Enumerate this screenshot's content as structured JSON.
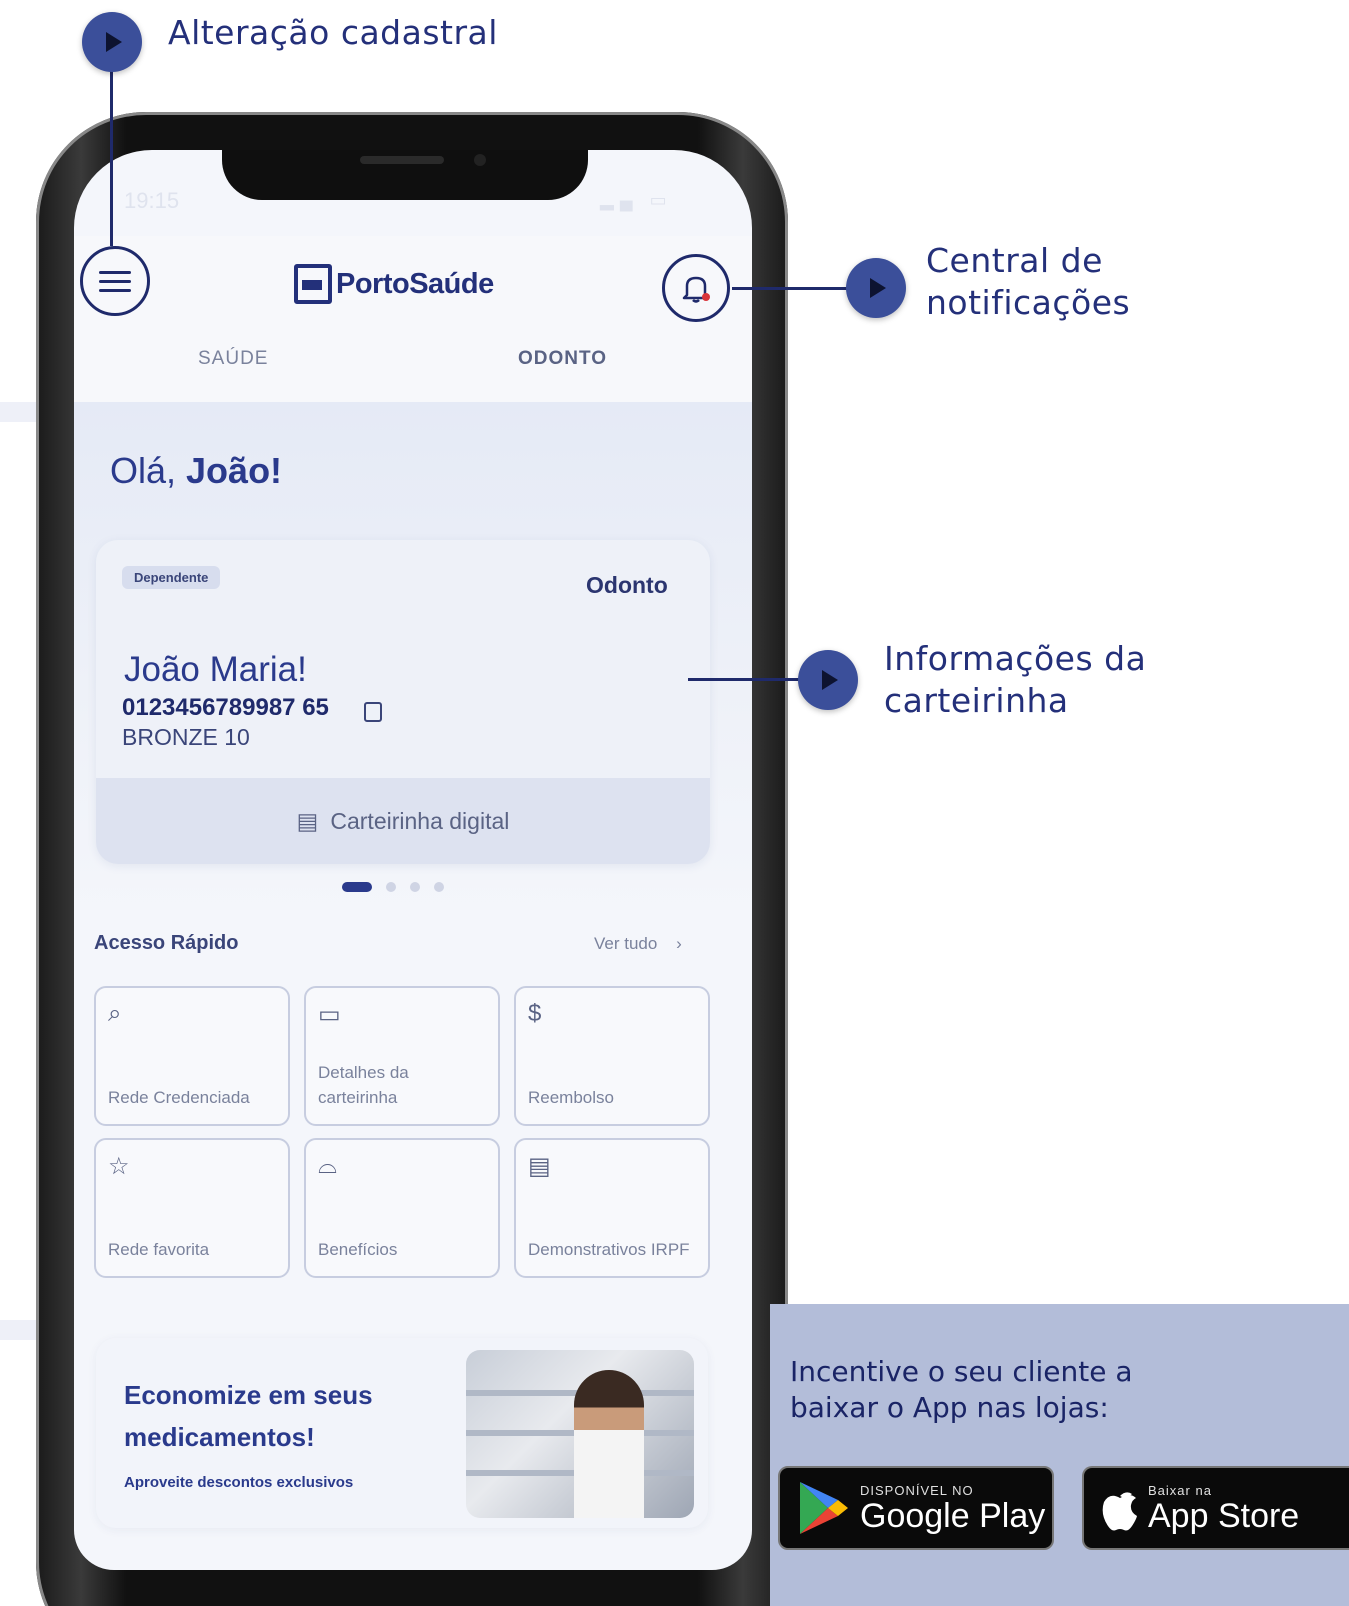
{
  "callouts": {
    "profile": "Alteração cadastral",
    "notifications_line1": "Central de",
    "notifications_line2": "notificações",
    "card_line1": "Informações da",
    "card_line2": "carteirinha"
  },
  "status": {
    "time": "19:15"
  },
  "app": {
    "logo_text": "PortoSaúde",
    "tabs": [
      {
        "label": "SAÚDE",
        "active": false
      },
      {
        "label": "ODONTO",
        "active": true
      }
    ],
    "greeting_prefix": "Olá, ",
    "greeting_name": "João!",
    "card": {
      "badge": "Dependente",
      "type": "Odonto",
      "name": "João Maria!",
      "number": "0123456789987 65",
      "plan": "BRONZE 10",
      "button": "Carteirinha digital"
    },
    "quick_access": {
      "title": "Acesso Rápido",
      "see_all": "Ver tudo",
      "tiles": [
        {
          "icon": "search-icon",
          "label": "Rede Credenciada"
        },
        {
          "icon": "card-icon",
          "label": "Detalhes da carteirinha"
        },
        {
          "icon": "dollar-icon",
          "label": "Reembolso"
        },
        {
          "icon": "star-icon",
          "label": "Rede favorita"
        },
        {
          "icon": "gift-icon",
          "label": "Benefícios"
        },
        {
          "icon": "document-icon",
          "label": "Demonstrativos IRPF"
        }
      ]
    },
    "promo": {
      "title": "Economize em seus medicamentos!",
      "subtitle": "Aproveite descontos exclusivos"
    }
  },
  "download": {
    "text": "Incentive o seu cliente a baixar o App nas lojas:",
    "google_small": "DISPONÍVEL NO",
    "google_big": "Google Play",
    "apple_small": "Baixar na",
    "apple_big": "App Store"
  },
  "colors": {
    "brand": "#23307a",
    "callout_dot": "#3b4f9a",
    "panel": "#b3bdd9"
  }
}
